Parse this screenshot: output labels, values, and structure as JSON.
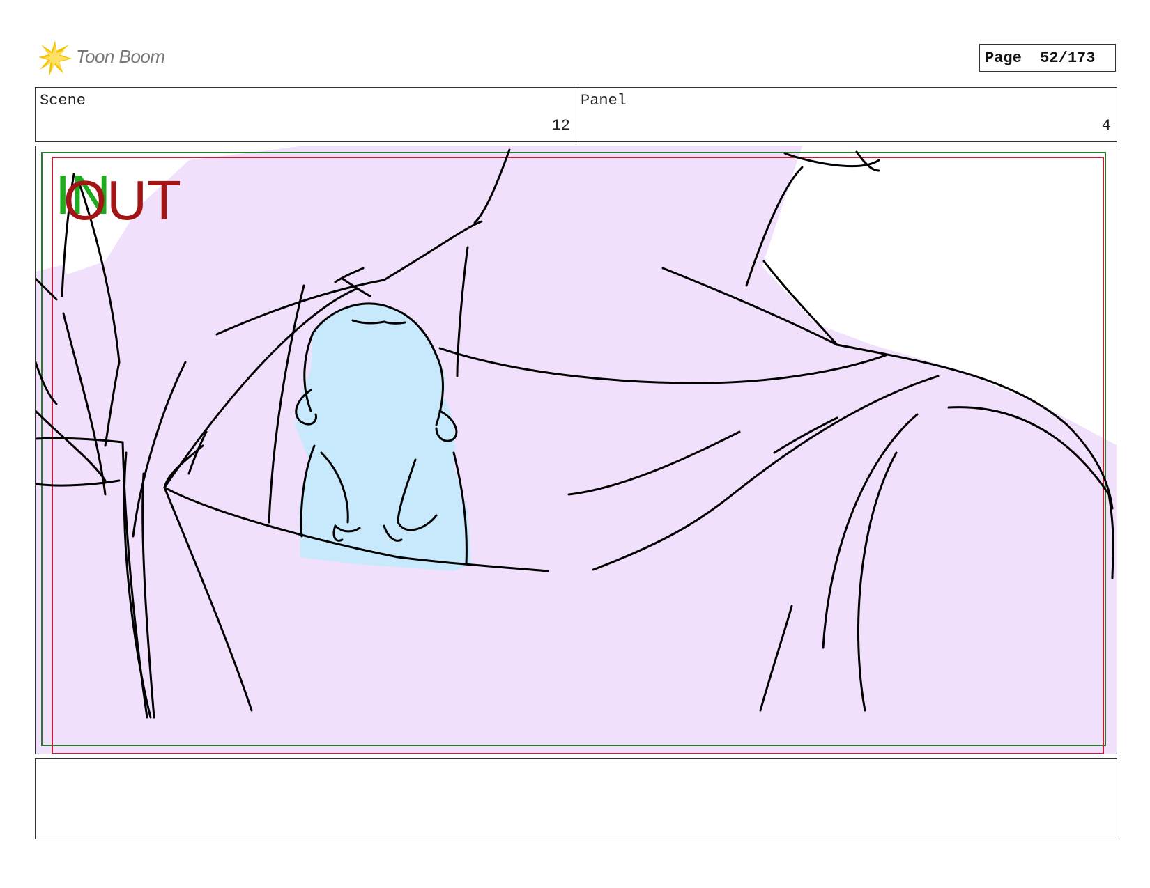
{
  "brand": {
    "name": "Toon Boom",
    "accent": "#f5c400"
  },
  "page": {
    "label": "Page",
    "current": "52",
    "total": "173",
    "display": "Page  52/173"
  },
  "scene": {
    "label": "Scene",
    "value": "12"
  },
  "panel": {
    "label": "Panel",
    "value": "4"
  },
  "safe_area": {
    "in_label": "IN",
    "out_label": "OUT",
    "in_color": "#1faa1f",
    "out_color": "#a31515"
  },
  "drawing": {
    "background_fill": "#f1e0fc",
    "frog_fill": "#c8e9fb",
    "line_color": "#000000"
  },
  "notes": {
    "text": ""
  }
}
